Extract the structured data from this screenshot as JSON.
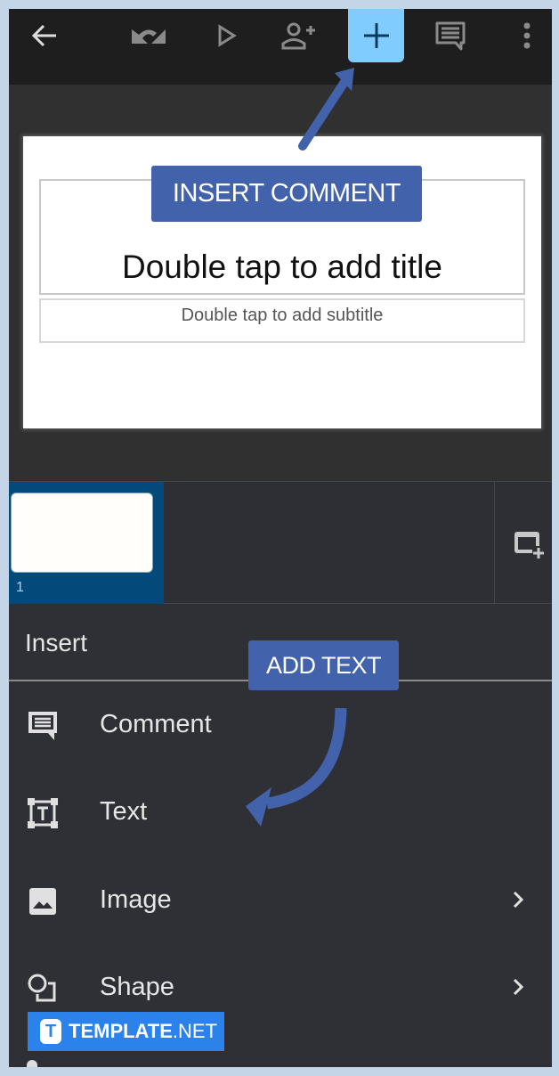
{
  "toolbar": {
    "icons": [
      {
        "name": "back-arrow-icon"
      },
      {
        "name": "undo-icon"
      },
      {
        "name": "play-icon"
      },
      {
        "name": "add-person-icon"
      },
      {
        "name": "insert-plus-icon"
      },
      {
        "name": "comment-icon"
      },
      {
        "name": "more-options-icon"
      }
    ],
    "insert_button_color": "#80ccff"
  },
  "slide": {
    "title_placeholder": "Double tap to add title",
    "subtitle_placeholder": "Double tap to add subtitle"
  },
  "filmstrip": {
    "slides": [
      {
        "number": "1",
        "selected": true
      }
    ],
    "selected_color": "#03497a"
  },
  "insert_menu": {
    "header": "Insert",
    "items": [
      {
        "label": "Comment",
        "icon": "comment-icon",
        "has_submenu": false
      },
      {
        "label": "Text",
        "icon": "text-box-icon",
        "has_submenu": false
      },
      {
        "label": "Image",
        "icon": "image-icon",
        "has_submenu": true
      },
      {
        "label": "Shape",
        "icon": "shape-icon",
        "has_submenu": true
      }
    ]
  },
  "callouts": {
    "insert_comment": "INSERT COMMENT",
    "add_text": "ADD TEXT",
    "color": "#4262ab"
  },
  "watermark": {
    "logo_letter": "T",
    "brand_bold": "TEMPLATE",
    "brand_light": ".NET",
    "color": "#2a82ea"
  }
}
